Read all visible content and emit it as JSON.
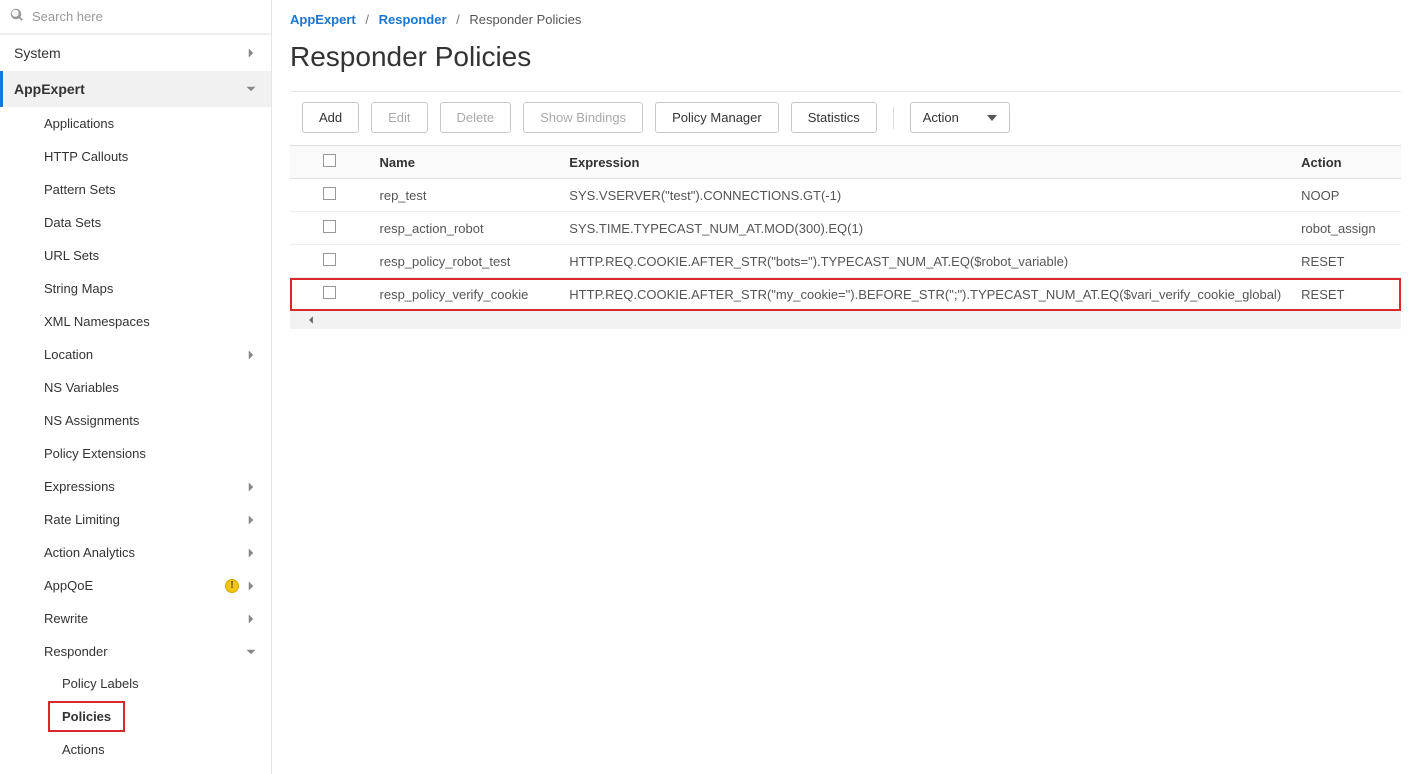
{
  "search": {
    "placeholder": "Search here"
  },
  "sidebar": {
    "top": [
      {
        "label": "System",
        "expandable": true
      },
      {
        "label": "AppExpert",
        "expandable": true,
        "expanded": true
      }
    ],
    "appexpert": [
      {
        "label": "Applications"
      },
      {
        "label": "HTTP Callouts"
      },
      {
        "label": "Pattern Sets"
      },
      {
        "label": "Data Sets"
      },
      {
        "label": "URL Sets"
      },
      {
        "label": "String Maps"
      },
      {
        "label": "XML Namespaces"
      },
      {
        "label": "Location",
        "chevron": true
      },
      {
        "label": "NS Variables"
      },
      {
        "label": "NS Assignments"
      },
      {
        "label": "Policy Extensions"
      },
      {
        "label": "Expressions",
        "chevron": true
      },
      {
        "label": "Rate Limiting",
        "chevron": true
      },
      {
        "label": "Action Analytics",
        "chevron": true
      },
      {
        "label": "AppQoE",
        "chevron": true,
        "warn": true
      },
      {
        "label": "Rewrite",
        "chevron": true
      },
      {
        "label": "Responder",
        "chevron": true,
        "expanded": true
      }
    ],
    "responder": [
      {
        "label": "Policy Labels"
      },
      {
        "label": "Policies",
        "selected": true
      },
      {
        "label": "Actions"
      }
    ]
  },
  "breadcrumb": {
    "a": "AppExpert",
    "b": "Responder",
    "c": "Responder Policies"
  },
  "page_title": "Responder Policies",
  "toolbar": {
    "add": "Add",
    "edit": "Edit",
    "delete": "Delete",
    "show_bindings": "Show Bindings",
    "policy_manager": "Policy Manager",
    "statistics": "Statistics",
    "action": "Action"
  },
  "table": {
    "cols": {
      "name": "Name",
      "expression": "Expression",
      "action": "Action"
    },
    "rows": [
      {
        "name": "rep_test",
        "expression": "SYS.VSERVER(\"test\").CONNECTIONS.GT(-1)",
        "action": "NOOP"
      },
      {
        "name": "resp_action_robot",
        "expression": "SYS.TIME.TYPECAST_NUM_AT.MOD(300).EQ(1)",
        "action": "robot_assign"
      },
      {
        "name": "resp_policy_robot_test",
        "expression": "HTTP.REQ.COOKIE.AFTER_STR(\"bots=\").TYPECAST_NUM_AT.EQ($robot_variable)",
        "action": "RESET"
      },
      {
        "name": "resp_policy_verify_cookie",
        "expression": "HTTP.REQ.COOKIE.AFTER_STR(\"my_cookie=\").BEFORE_STR(\";\").TYPECAST_NUM_AT.EQ($vari_verify_cookie_global)",
        "action": "RESET",
        "highlight": true
      }
    ]
  }
}
